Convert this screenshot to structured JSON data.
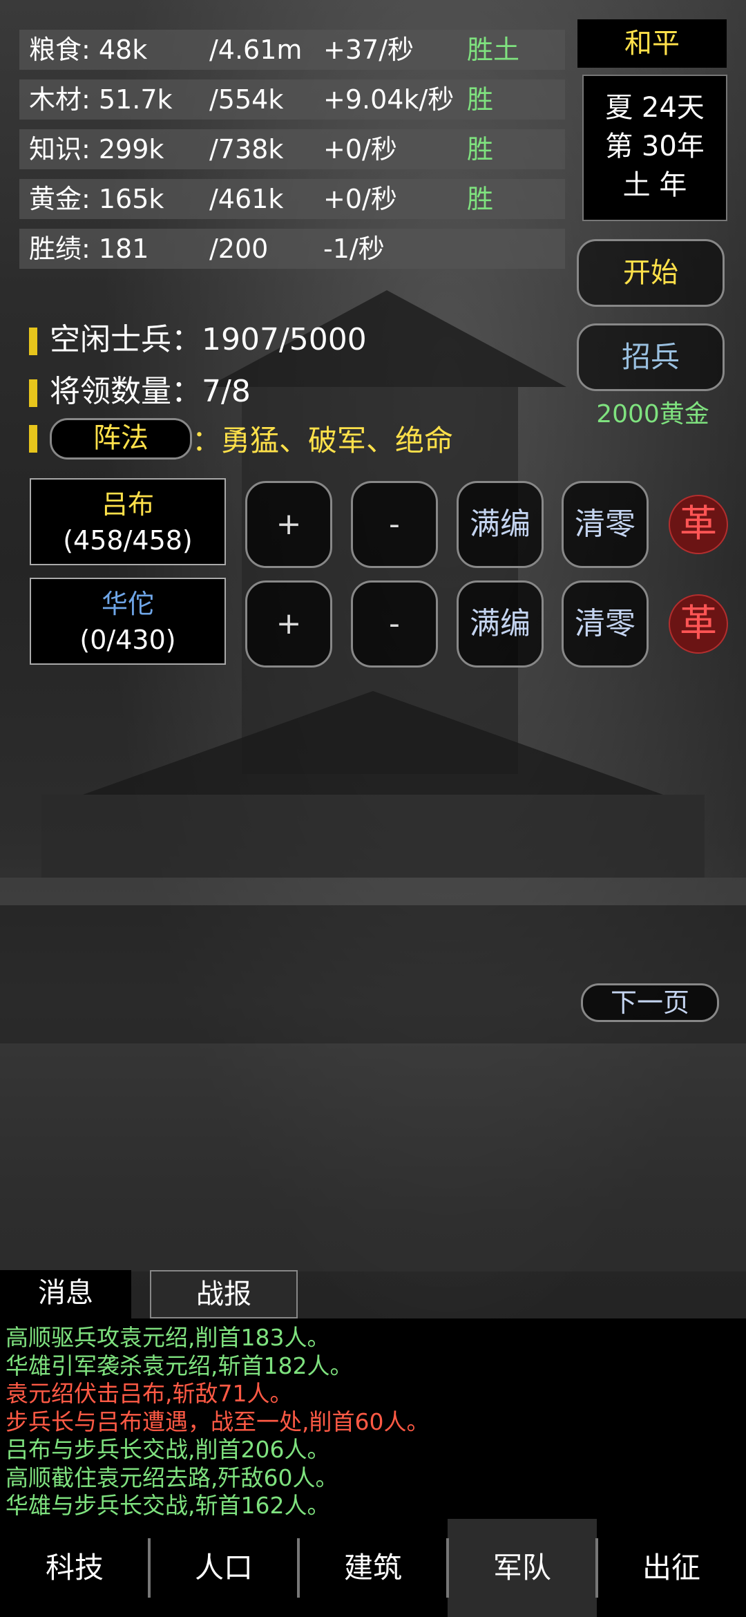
{
  "resources": [
    {
      "name": "粮食: 48k",
      "cap": "/4.61m",
      "rate": "+37/秒",
      "tag": "胜土"
    },
    {
      "name": "木材: 51.7k",
      "cap": "/554k",
      "rate": "+9.04k/秒",
      "tag": "胜"
    },
    {
      "name": "知识: 299k",
      "cap": "/738k",
      "rate": "+0/秒",
      "tag": "胜"
    },
    {
      "name": "黄金: 165k",
      "cap": "/461k",
      "rate": "+0/秒",
      "tag": "胜"
    },
    {
      "name": "胜绩: 181",
      "cap": "/200",
      "rate": "-1/秒",
      "tag": ""
    }
  ],
  "status": {
    "peace": "和平",
    "date_line1": "夏 24天",
    "date_line2": "第 30年",
    "date_line3": "土 年"
  },
  "buttons": {
    "start": "开始",
    "recruit": "招兵",
    "recruit_cost": "2000黄金",
    "next_page": "下一页"
  },
  "army": {
    "idle_soldiers": "空闲士兵：1907/5000",
    "generals_count": "将领数量：7/8",
    "formation_label": "阵法",
    "formation_colon": "：",
    "formation_value": "勇猛、破军、绝命"
  },
  "generals": [
    {
      "name": "吕布",
      "troops": "(458/458)",
      "name_color": "#ffe14a"
    },
    {
      "name": "华佗",
      "troops": "(0/430)",
      "name_color": "#6fa6e8"
    }
  ],
  "actions": {
    "plus": "+",
    "minus": "-",
    "fill": "满编",
    "clear": "清零",
    "dismiss": "革"
  },
  "tabs": {
    "messages": "消息",
    "reports": "战报"
  },
  "log": [
    {
      "text": "高顺驱兵攻袁元绍,削首183人。",
      "color": "#7fe27f"
    },
    {
      "text": "华雄引军袭杀袁元绍,斩首182人。",
      "color": "#7fe27f"
    },
    {
      "text": "袁元绍伏击吕布,斩敌71人。",
      "color": "#ff5a45"
    },
    {
      "text": "步兵长与吕布遭遇，战至一处,削首60人。",
      "color": "#ff5a45"
    },
    {
      "text": "吕布与步兵长交战,削首206人。",
      "color": "#7fe27f"
    },
    {
      "text": "高顺截住袁元绍去路,歼敌60人。",
      "color": "#7fe27f"
    },
    {
      "text": "华雄与步兵长交战,斩首162人。",
      "color": "#7fe27f"
    }
  ],
  "nav": [
    "科技",
    "人口",
    "建筑",
    "军队",
    "出征"
  ],
  "nav_active_index": 3
}
